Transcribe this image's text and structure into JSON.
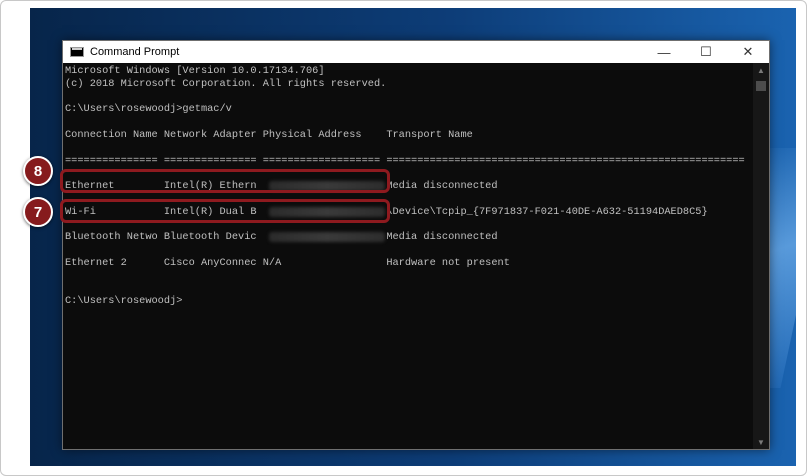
{
  "window": {
    "title": "Command Prompt",
    "minimize": "—",
    "maximize": "☐",
    "close": "✕"
  },
  "console": {
    "lines": [
      "Microsoft Windows [Version 10.0.17134.706]",
      "(c) 2018 Microsoft Corporation. All rights reserved.",
      "",
      "C:\\Users\\rosewoodj>getmac/v",
      "",
      "Connection Name Network Adapter Physical Address    Transport Name",
      "",
      "=============== =============== =================== ==========================================================",
      "---",
      "Ethernet        Intel(R) Ethern                     Media disconnected",
      "",
      "Wi-Fi           Intel(R) Dual B                     \\Device\\Tcpip_{7F971837-F021-40DE-A632-51194DAED8C5}",
      "",
      "Bluetooth Netwo Bluetooth Devic                     Media disconnected",
      "",
      "Ethernet 2      Cisco AnyConnec N/A                 Hardware not present",
      "",
      "",
      "C:\\Users\\rosewoodj>"
    ]
  },
  "callouts": {
    "badge_ethernet": "8",
    "badge_wifi": "7",
    "color": "#8e1a1f"
  },
  "scrollbar": {
    "up": "▲",
    "down": "▼"
  }
}
